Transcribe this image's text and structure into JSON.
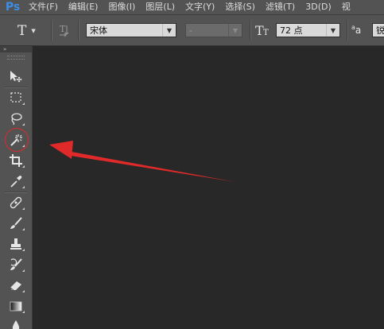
{
  "app": {
    "logo": "Ps"
  },
  "menu": [
    "文件(F)",
    "编辑(E)",
    "图像(I)",
    "图层(L)",
    "文字(Y)",
    "选择(S)",
    "滤镜(T)",
    "3D(D)",
    "视"
  ],
  "options_bar": {
    "tool_icon": "type-tool-icon",
    "tool_glyph": "T",
    "orientation_icon": "toggle-text-orientation-icon",
    "font_family": "宋体",
    "font_style": "-",
    "size_icon": "font-size-icon",
    "font_size": "72 点",
    "aa_label": "aa",
    "aa_prefix": "a",
    "aa_mode_partial": "锐"
  },
  "tools": [
    {
      "name": "move-tool",
      "icon": "move-icon"
    },
    {
      "name": "rectangular-marquee-tool",
      "icon": "marquee-icon"
    },
    {
      "name": "lasso-tool",
      "icon": "lasso-icon"
    },
    {
      "name": "magic-wand-tool",
      "icon": "magic-wand-icon"
    },
    {
      "name": "crop-tool",
      "icon": "crop-icon"
    },
    {
      "name": "eyedropper-tool",
      "icon": "eyedropper-icon"
    },
    {
      "name": "spot-healing-brush-tool",
      "icon": "bandage-icon"
    },
    {
      "name": "brush-tool",
      "icon": "brush-icon"
    },
    {
      "name": "clone-stamp-tool",
      "icon": "stamp-icon"
    },
    {
      "name": "history-brush-tool",
      "icon": "history-brush-icon"
    },
    {
      "name": "eraser-tool",
      "icon": "eraser-icon"
    },
    {
      "name": "gradient-tool",
      "icon": "gradient-icon"
    },
    {
      "name": "blur-tool",
      "icon": "drop-icon"
    }
  ],
  "annotation": {
    "color": "#e02a2a",
    "target": "magic-wand-tool"
  },
  "colors": {
    "panel": "#535353",
    "canvas": "#282828",
    "menubar": "#535353",
    "logo": "#3d8ee6"
  }
}
